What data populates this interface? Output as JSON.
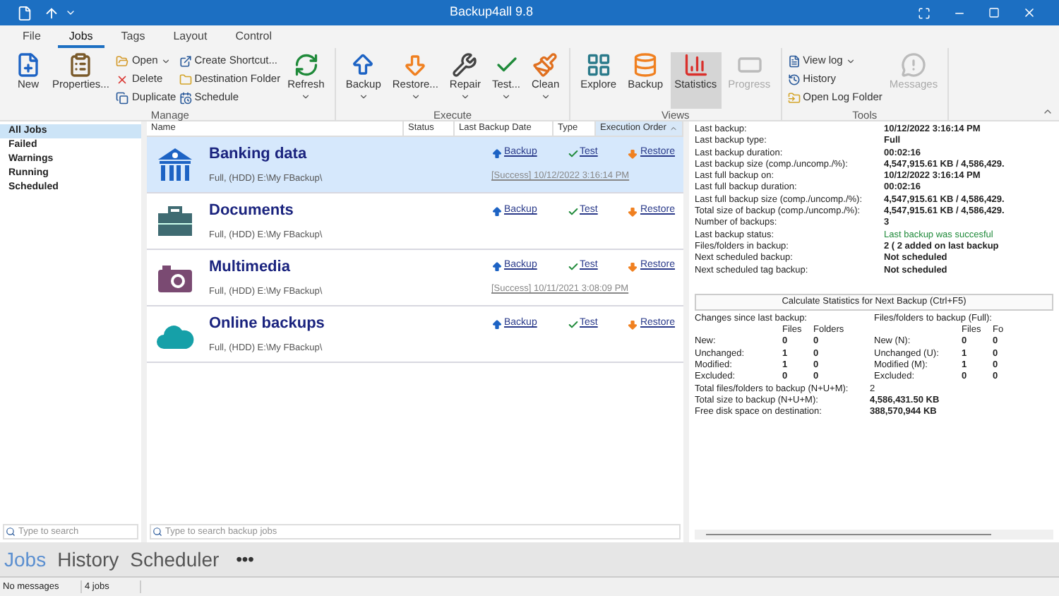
{
  "window": {
    "title": "Backup4all 9.8"
  },
  "menu_tabs": [
    {
      "label": "File",
      "selected": false
    },
    {
      "label": "Jobs",
      "selected": true
    },
    {
      "label": "Tags",
      "selected": false
    },
    {
      "label": "Layout",
      "selected": false
    },
    {
      "label": "Control",
      "selected": false
    }
  ],
  "ribbon": [
    {
      "label": "Manage",
      "columns": [
        {
          "kind": "large",
          "label": "New",
          "dropdown": false,
          "selected": false,
          "disabled": false
        },
        {
          "kind": "large",
          "label": "Properties...",
          "dropdown": false,
          "selected": false,
          "disabled": false
        },
        {
          "kind": "stack",
          "items": [
            {
              "label": "Open",
              "dropdown": true
            },
            {
              "label": "Delete",
              "dropdown": false
            },
            {
              "label": "Duplicate",
              "dropdown": false
            }
          ]
        },
        {
          "kind": "stack",
          "items": [
            {
              "label": "Create Shortcut...",
              "dropdown": false
            },
            {
              "label": "Destination Folder",
              "dropdown": false
            },
            {
              "label": "Schedule",
              "dropdown": false
            }
          ]
        },
        {
          "kind": "large",
          "label": "Refresh",
          "dropdown": true,
          "selected": false,
          "disabled": false
        }
      ]
    },
    {
      "label": "Execute",
      "columns": [
        {
          "kind": "large",
          "label": "Backup",
          "dropdown": true,
          "selected": false,
          "disabled": false
        },
        {
          "kind": "large",
          "label": "Restore...",
          "dropdown": true,
          "selected": false,
          "disabled": false
        },
        {
          "kind": "large",
          "label": "Repair",
          "dropdown": true,
          "selected": false,
          "disabled": false
        },
        {
          "kind": "large",
          "label": "Test...",
          "dropdown": true,
          "selected": false,
          "disabled": false
        },
        {
          "kind": "large",
          "label": "Clean",
          "dropdown": true,
          "selected": false,
          "disabled": false
        }
      ]
    },
    {
      "label": "Views",
      "columns": [
        {
          "kind": "large",
          "label": "Explore",
          "dropdown": false,
          "selected": false,
          "disabled": false
        },
        {
          "kind": "large",
          "label": "Backup",
          "dropdown": false,
          "selected": false,
          "disabled": false
        },
        {
          "kind": "large",
          "label": "Statistics",
          "dropdown": false,
          "selected": true,
          "disabled": false
        },
        {
          "kind": "large",
          "label": "Progress",
          "dropdown": false,
          "selected": false,
          "disabled": true
        }
      ]
    },
    {
      "label": "Tools",
      "columns": [
        {
          "kind": "stack",
          "items": [
            {
              "label": "View log",
              "dropdown": true
            },
            {
              "label": "History",
              "dropdown": false
            },
            {
              "label": "Open Log Folder",
              "dropdown": false
            }
          ]
        },
        {
          "kind": "large",
          "label": "Messages",
          "dropdown": false,
          "selected": false,
          "disabled": true
        }
      ]
    }
  ],
  "filters": [
    {
      "label": "All Jobs",
      "selected": true
    },
    {
      "label": "Failed",
      "selected": false
    },
    {
      "label": "Warnings",
      "selected": false
    },
    {
      "label": "Running",
      "selected": false
    },
    {
      "label": "Scheduled",
      "selected": false
    }
  ],
  "filter_search": {
    "placeholder": "Type to search"
  },
  "columns": [
    {
      "label": "Name",
      "sorted": false
    },
    {
      "label": "Status",
      "sorted": false
    },
    {
      "label": "Last Backup Date",
      "sorted": false
    },
    {
      "label": "Type",
      "sorted": false
    },
    {
      "label": "Execution Order",
      "sorted": true
    }
  ],
  "jobs": [
    {
      "name": "Banking data",
      "detail": "Full, (HDD) E:\\My FBackup\\",
      "actions": [
        "Backup",
        "Test",
        "Restore"
      ],
      "last_result": "[Success] 10/12/2022 3:16:14 PM",
      "selected": true
    },
    {
      "name": "Documents",
      "detail": "Full, (HDD) E:\\My FBackup\\",
      "actions": [
        "Backup",
        "Test",
        "Restore"
      ],
      "selected": false
    },
    {
      "name": "Multimedia",
      "detail": "Full, (HDD) E:\\My FBackup\\",
      "actions": [
        "Backup",
        "Test",
        "Restore"
      ],
      "last_result": "[Success] 10/11/2021 3:08:09 PM",
      "selected": false
    },
    {
      "name": "Online backups",
      "detail": "Full, (HDD) E:\\My FBackup\\",
      "actions": [
        "Backup",
        "Test",
        "Restore"
      ],
      "selected": false
    }
  ],
  "job_search": {
    "placeholder": "Type to search backup jobs"
  },
  "details": [
    {
      "label": "Last backup:",
      "value": "10/12/2022 3:16:14 PM",
      "success": false
    },
    {
      "label": "Last backup type:",
      "value": "Full",
      "success": false
    },
    {
      "label": "Last backup duration:",
      "value": "00:02:16",
      "success": false
    },
    {
      "label": "Last backup size (comp./uncomp./%):",
      "value": "4,547,915.61 KB / 4,586,429.",
      "success": false
    },
    {
      "label": "Last full backup on:",
      "value": "10/12/2022 3:16:14 PM",
      "success": false
    },
    {
      "label": "Last full backup duration:",
      "value": "00:02:16",
      "success": false
    },
    {
      "label": "Last full backup size (comp./uncomp./%):",
      "value": "4,547,915.61 KB / 4,586,429.",
      "success": false
    },
    {
      "label": "Total size of backup (comp./uncomp./%):",
      "value": "4,547,915.61 KB / 4,586,429.",
      "success": false
    },
    {
      "label": "Number of backups:",
      "value": "3",
      "success": false
    },
    {
      "label": "Last backup status:",
      "value": "Last backup was succesful",
      "success": true
    },
    {
      "label": "Files/folders in backup:",
      "value": "2   ( 2 added on last backup",
      "success": false
    },
    {
      "label": "Next scheduled backup:",
      "value": "Not scheduled",
      "success": false
    },
    {
      "label": "Next scheduled tag backup:",
      "value": "Not scheduled",
      "success": false
    }
  ],
  "calculate_button": "Calculate Statistics for Next Backup (Ctrl+F5)",
  "change_tables": [
    {
      "title": "Changes since last backup:",
      "headers": [
        "Files",
        "Folders"
      ],
      "rows": [
        {
          "label": "New:",
          "values": [
            "0",
            "0"
          ]
        },
        {
          "label": "Unchanged:",
          "values": [
            "1",
            "0"
          ]
        },
        {
          "label": "Modified:",
          "values": [
            "1",
            "0"
          ]
        },
        {
          "label": "Excluded:",
          "values": [
            "0",
            "0"
          ]
        }
      ]
    },
    {
      "title": "Files/folders to backup (Full):",
      "headers": [
        "Files",
        "Fo"
      ],
      "rows": [
        {
          "label": "New (N):",
          "values": [
            "0",
            "0"
          ]
        },
        {
          "label": "Unchanged (U):",
          "values": [
            "1",
            "0"
          ]
        },
        {
          "label": "Modified (M):",
          "values": [
            "1",
            "0"
          ]
        },
        {
          "label": "Excluded:",
          "values": [
            "0",
            "0"
          ]
        }
      ]
    }
  ],
  "totals": [
    {
      "label": "Total files/folders to backup (N+U+M):",
      "value": "2",
      "emphasis": false
    },
    {
      "label": "Total size to backup (N+U+M):",
      "value": "4,586,431.50 KB",
      "emphasis": true
    },
    {
      "label": "Free disk space on destination:",
      "value": "388,570,944 KB",
      "emphasis": true
    }
  ],
  "bottom_nav": [
    {
      "label": "Jobs",
      "selected": true
    },
    {
      "label": "History",
      "selected": false
    },
    {
      "label": "Scheduler",
      "selected": false
    }
  ],
  "more_button": "•••",
  "status_bar": [
    "No messages",
    "4 jobs"
  ]
}
